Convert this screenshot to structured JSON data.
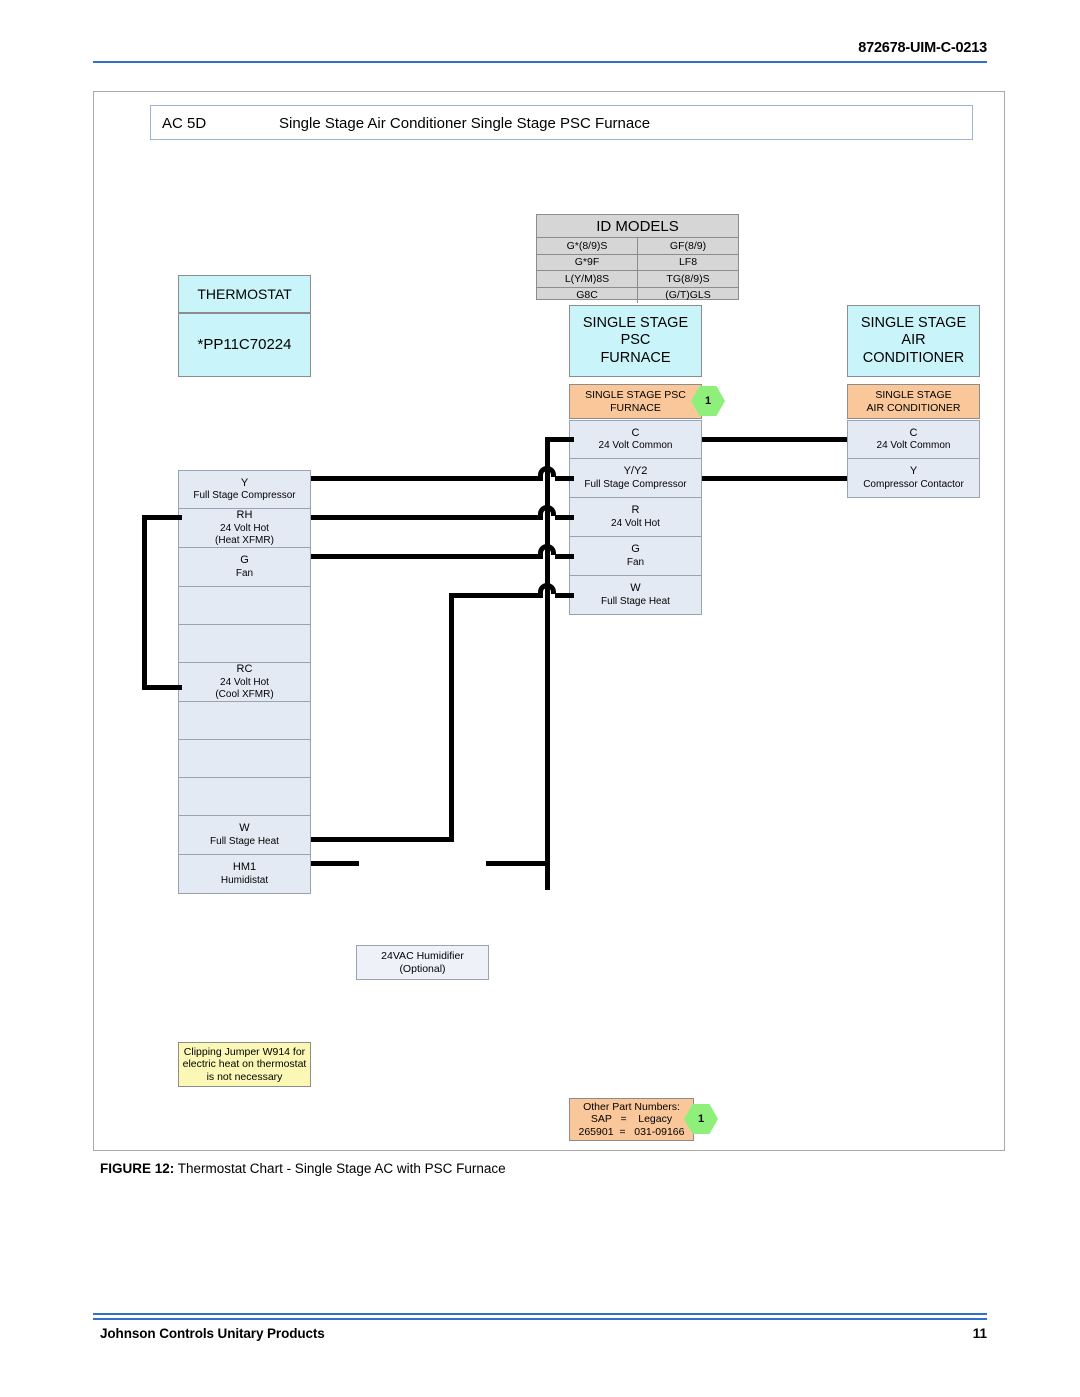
{
  "page": {
    "doc_code": "872678-UIM-C-0213",
    "footer_left": "Johnson Controls Unitary Products",
    "page_number": "11"
  },
  "figure": {
    "title_code": "AC 5D",
    "title_text": "Single Stage Air Conditioner Single Stage PSC Furnace",
    "caption_label": "FIGURE 12:",
    "caption_text": "Thermostat Chart - Single Stage AC with PSC Furnace"
  },
  "id_models": {
    "header": "ID MODELS",
    "rows": [
      [
        "G*(8/9)S",
        "GF(8/9)"
      ],
      [
        "G*9F",
        "LF8"
      ],
      [
        "L(Y/M)8S",
        "TG(8/9)S"
      ],
      [
        "G8C",
        "(G/T)GLS"
      ]
    ]
  },
  "thermostat": {
    "header": "THERMOSTAT",
    "model": "*PP11C70224",
    "terminals": [
      {
        "code": "Y",
        "desc": "Full Stage Compressor"
      },
      {
        "code": "RH",
        "desc": "24    Volt Hot",
        "desc2": "(Heat XFMR)"
      },
      {
        "code": "G",
        "desc": "Fan"
      },
      {
        "code": "",
        "desc": ""
      },
      {
        "code": "",
        "desc": ""
      },
      {
        "code": "RC",
        "desc": "24    Volt Hot",
        "desc2": "(Cool XFMR)"
      },
      {
        "code": "",
        "desc": ""
      },
      {
        "code": "",
        "desc": ""
      },
      {
        "code": "",
        "desc": ""
      },
      {
        "code": "W",
        "desc": "Full Stage Heat"
      },
      {
        "code": "HM1",
        "desc": "Humidistat"
      }
    ]
  },
  "furnace": {
    "header_line1": "SINGLE STAGE",
    "header_line2": "PSC",
    "header_line3": "FURNACE",
    "sub_line1": "SINGLE STAGE PSC",
    "sub_line2": "FURNACE",
    "badge": "1",
    "terminals": [
      {
        "code": "C",
        "desc": "24    Volt Common"
      },
      {
        "code": "Y/Y2",
        "desc": "Full Stage Compressor"
      },
      {
        "code": "R",
        "desc": "24    Volt Hot"
      },
      {
        "code": "G",
        "desc": "Fan"
      },
      {
        "code": "W",
        "desc": "Full Stage Heat"
      }
    ]
  },
  "air_conditioner": {
    "header_line1": "SINGLE STAGE",
    "header_line2": "AIR",
    "header_line3": "CONDITIONER",
    "sub_line1": "SINGLE STAGE",
    "sub_line2": "AIR CONDITIONER",
    "terminals": [
      {
        "code": "C",
        "desc": "24    Volt Common"
      },
      {
        "code": "Y",
        "desc": "Compressor Contactor"
      }
    ]
  },
  "humidifier": {
    "line1": "24VAC Humidifier",
    "line2": "(Optional)"
  },
  "note_jumper": {
    "line1": "Clipping Jumper W914 for",
    "line2": "electric heat on thermostat",
    "line3": "is not necessary"
  },
  "legend": {
    "line1": "Other Part Numbers:",
    "line2": "SAP   =    Legacy",
    "line3": "265901  =   031-09166",
    "badge": "1"
  },
  "colors": {
    "accent_blue": "#2f6fd0",
    "cyan_box": "#c9f4f9",
    "orange_box": "#f9c79a",
    "terminal_box": "#e4eaf4",
    "note_yellow": "#fbf8b6",
    "badge_green": "#8ef07a"
  }
}
